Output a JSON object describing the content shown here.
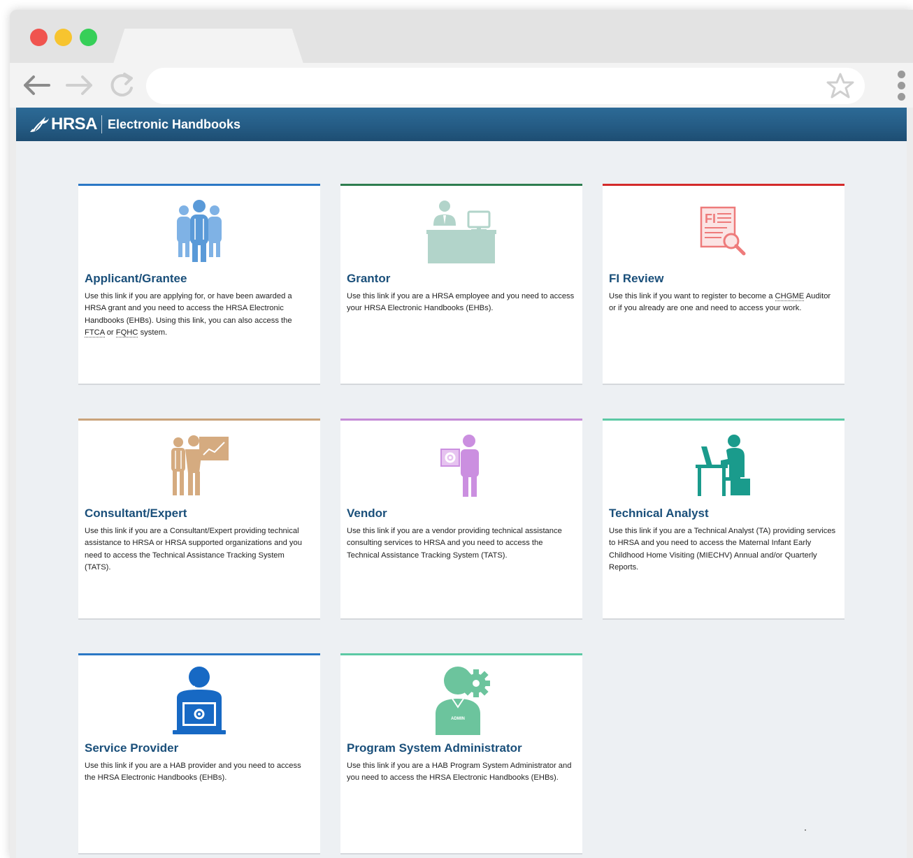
{
  "header": {
    "brand": "HRSA",
    "app_title": "Electronic Handbooks"
  },
  "cards": [
    {
      "title": "Applicant/Grantee",
      "accent": "#2b78c5",
      "icon": "people-group-icon",
      "desc_1": "Use this link if you are applying for, or have been awarded a HRSA grant and you need to access the HRSA Electronic Handbooks (EHBs). Using this link, you can also access the ",
      "link_1": "FTCA",
      "desc_2": " or ",
      "link_2": "FQHC",
      "desc_3": " system."
    },
    {
      "title": "Grantor",
      "accent": "#2e7d4f",
      "icon": "employee-desk-icon",
      "desc": "Use this link if you are a HRSA employee and you need to access your HRSA Electronic Handbooks (EHBs)."
    },
    {
      "title": "FI Review",
      "accent": "#d42a2a",
      "icon": "document-search-icon",
      "desc_1": "Use this link if you want to register to become a ",
      "link_1": "CHGME",
      "desc_2": " Auditor or if you already are one and need to access your work."
    },
    {
      "title": "Consultant/Expert",
      "accent": "#c9a37a",
      "icon": "presenter-board-icon",
      "desc": "Use this link if you are a Consultant/Expert providing technical assistance to HRSA or HRSA supported organizations and you need to access the Technical Assistance Tracking System (TATS)."
    },
    {
      "title": "Vendor",
      "accent": "#c58bd6",
      "icon": "vendor-gear-icon",
      "desc": "Use this link if you are a vendor providing technical assistance consulting services to HRSA and you need to access the Technical Assistance Tracking System (TATS)."
    },
    {
      "title": "Technical Analyst",
      "accent": "#5cc9a4",
      "icon": "analyst-computer-icon",
      "desc": "Use this link if you are a Technical Analyst (TA) providing services to HRSA and you need to access the Maternal Infant Early Childhood Home Visiting (MIECHV) Annual and/or Quarterly Reports."
    },
    {
      "title": "Service Provider",
      "accent": "#2b78c5",
      "icon": "service-provider-laptop-icon",
      "desc": "Use this link if you are a HAB provider and you need to access the HRSA Electronic Handbooks (EHBs)."
    },
    {
      "title": "Program System Administrator",
      "accent": "#5cc9a4",
      "icon": "admin-gear-icon",
      "icon_label": "ADMIN",
      "desc": "Use this link if you are a HAB Program System Administrator and you need to access the HRSA Electronic Handbooks (EHBs)."
    }
  ]
}
